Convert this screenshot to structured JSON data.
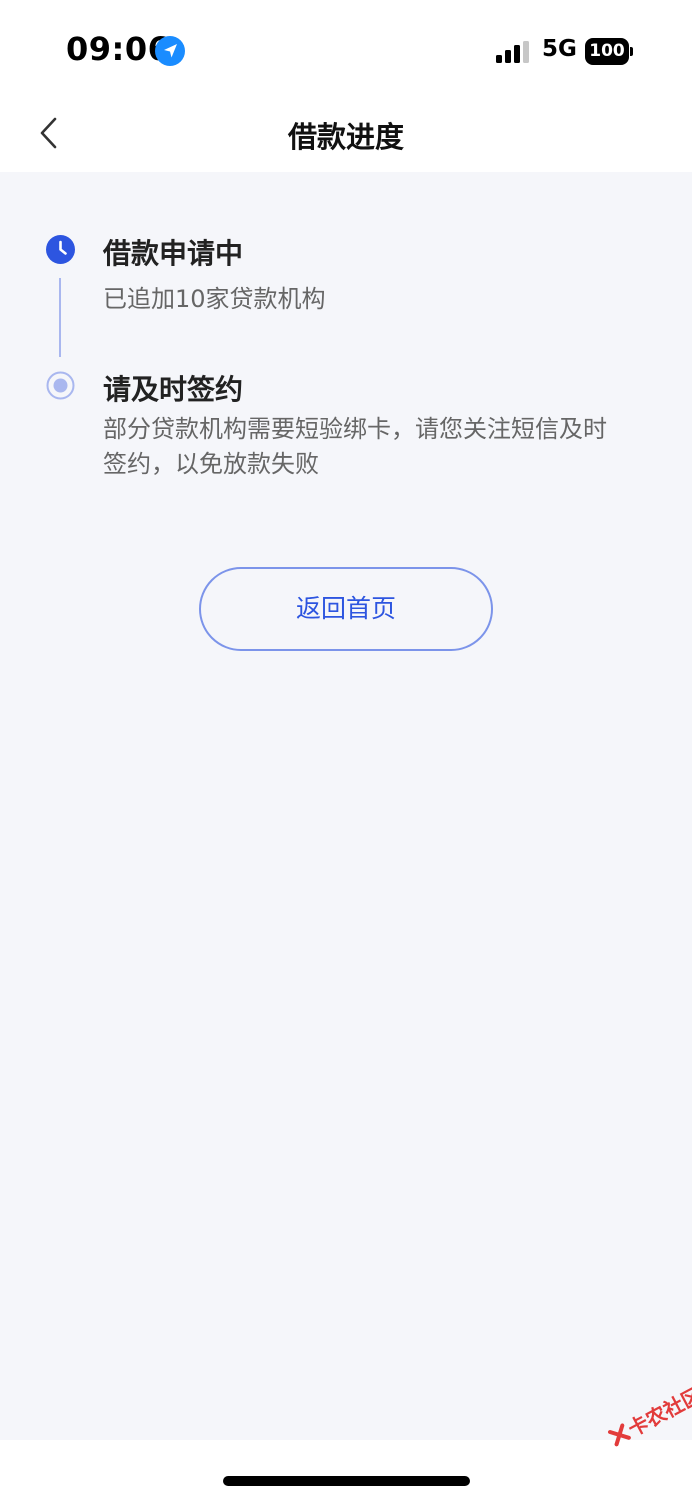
{
  "status_bar": {
    "time": "09:06",
    "network": "5G",
    "battery": "100"
  },
  "header": {
    "title": "借款进度"
  },
  "steps": [
    {
      "title": "借款申请中",
      "description": "已追加10家贷款机构",
      "state": "active"
    },
    {
      "title": "请及时签约",
      "description": "部分贷款机构需要短验绑卡，请您关注短信及时签约，以免放款失败",
      "state": "pending"
    }
  ],
  "actions": {
    "home_button": "返回首页"
  },
  "watermark": {
    "text": "卡农社区"
  },
  "colors": {
    "accent": "#2d55e0",
    "button_border": "#7c94ea",
    "timeline_line": "#a9b7ef",
    "background": "#f5f6fa"
  }
}
